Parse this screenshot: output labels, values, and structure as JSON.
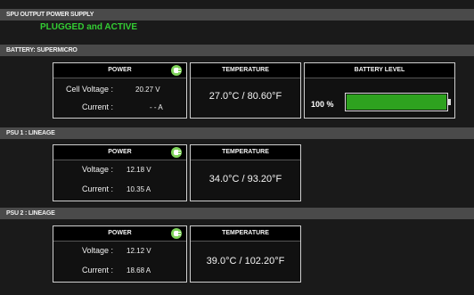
{
  "spu": {
    "header": "SPU OUTPUT POWER SUPPLY",
    "status": "PLUGGED and ACTIVE",
    "status_color": "#33cc33"
  },
  "battery": {
    "header": "BATTERY: SUPERMICRO",
    "power_title": "POWER",
    "power_icon": "plug-icon",
    "voltage_label": "Cell Voltage :",
    "voltage_value": "20.27 V",
    "current_label": "Current :",
    "current_value": "- - A",
    "temp_title": "TEMPERATURE",
    "temp_value": "27.0°C / 80.60°F",
    "level_title": "BATTERY LEVEL",
    "level_text": "100 %",
    "level_fraction": 1.0,
    "level_color": "#2ea21f"
  },
  "psu1": {
    "header": "PSU 1 : LINEAGE",
    "power_title": "POWER",
    "power_icon": "plug-icon",
    "voltage_label": "Voltage :",
    "voltage_value": "12.18 V",
    "current_label": "Current :",
    "current_value": "10.35 A",
    "temp_title": "TEMPERATURE",
    "temp_value": "34.0°C / 93.20°F"
  },
  "psu2": {
    "header": "PSU 2 : LINEAGE",
    "power_title": "POWER",
    "power_icon": "plug-icon",
    "voltage_label": "Voltage :",
    "voltage_value": "12.12 V",
    "current_label": "Current :",
    "current_value": "18.68 A",
    "temp_title": "TEMPERATURE",
    "temp_value": "39.0°C / 102.20°F"
  }
}
